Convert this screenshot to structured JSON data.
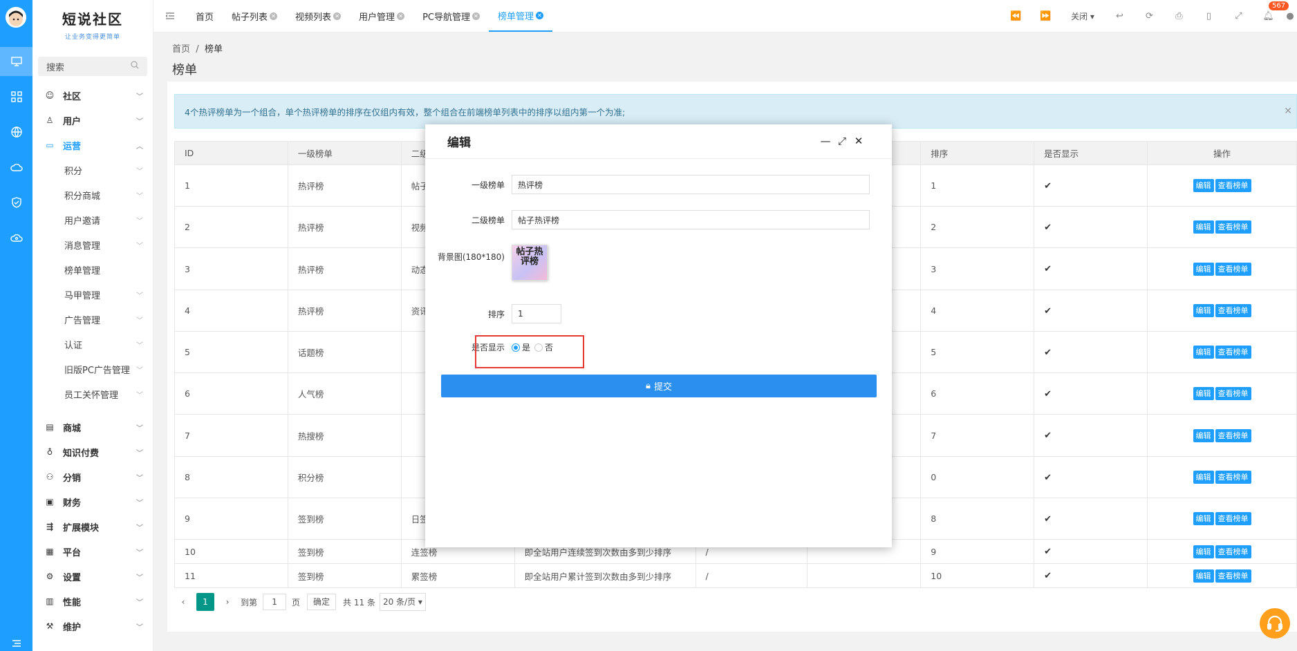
{
  "app": {
    "logo_title": "短说社区",
    "logo_slogan": "让业务变得更简单",
    "badge_count": "567"
  },
  "sidebar": {
    "search_placeholder": "搜索",
    "items": [
      {
        "label": "社区",
        "icon": "chat-icon"
      },
      {
        "label": "用户",
        "icon": "user-icon"
      },
      {
        "label": "运营",
        "icon": "monitor-icon"
      }
    ],
    "sub_items": [
      {
        "label": "积分",
        "chev": "true"
      },
      {
        "label": "积分商城",
        "chev": "true"
      },
      {
        "label": "用户邀请",
        "chev": "true"
      },
      {
        "label": "消息管理",
        "chev": "true"
      },
      {
        "label": "榜单管理",
        "chev": ""
      },
      {
        "label": "马甲管理",
        "chev": "true"
      },
      {
        "label": "广告管理",
        "chev": "true"
      },
      {
        "label": "认证",
        "chev": "true"
      },
      {
        "label": "旧版PC广告管理",
        "chev": "true"
      },
      {
        "label": "员工关怀管理",
        "chev": "true"
      }
    ],
    "items_bottom": [
      {
        "label": "商城"
      },
      {
        "label": "知识付费"
      },
      {
        "label": "分销"
      },
      {
        "label": "财务"
      },
      {
        "label": "扩展模块"
      },
      {
        "label": "平台"
      },
      {
        "label": "设置"
      },
      {
        "label": "性能"
      },
      {
        "label": "维护"
      }
    ]
  },
  "tabs": [
    {
      "label": "首页"
    },
    {
      "label": "帖子列表"
    },
    {
      "label": "视频列表"
    },
    {
      "label": "用户管理"
    },
    {
      "label": "PC导航管理"
    },
    {
      "label": "榜单管理"
    }
  ],
  "toolbar": {
    "close_label": "关闭"
  },
  "breadcrumb": {
    "home": "首页",
    "current": "榜单"
  },
  "page_title": "榜单",
  "alert_text": "4个热评榜单为一个组合，单个热评榜单的排序在仅组内有效，整个组合在前端榜单列表中的排序以组内第一个为准;",
  "table": {
    "headers": {
      "id": "ID",
      "level1": "一级榜单",
      "level2": "二级",
      "sort": "排序",
      "show": "是否显示",
      "op": "操作"
    },
    "edit_label": "编辑",
    "view_label": "查看榜单",
    "rows": [
      {
        "id": "1",
        "l1": "热评榜",
        "l2": "帖子",
        "desc": "",
        "c5": "",
        "sort": "1"
      },
      {
        "id": "2",
        "l1": "热评榜",
        "l2": "视频",
        "desc": "",
        "c5": "",
        "sort": "2"
      },
      {
        "id": "3",
        "l1": "热评榜",
        "l2": "动态",
        "desc": "",
        "c5": "",
        "sort": "3"
      },
      {
        "id": "4",
        "l1": "热评榜",
        "l2": "资讯",
        "desc": "",
        "c5": "",
        "sort": "4"
      },
      {
        "id": "5",
        "l1": "话题榜",
        "l2": "",
        "desc": "",
        "c5": "",
        "sort": "5"
      },
      {
        "id": "6",
        "l1": "人气榜",
        "l2": "",
        "desc": "",
        "c5": "",
        "sort": "6"
      },
      {
        "id": "7",
        "l1": "热搜榜",
        "l2": "",
        "desc": "",
        "c5": "",
        "sort": "7"
      },
      {
        "id": "8",
        "l1": "积分榜",
        "l2": "",
        "desc": "",
        "c5": "",
        "sort": "0"
      },
      {
        "id": "9",
        "l1": "签到榜",
        "l2": "日签",
        "desc": "",
        "c5": "",
        "sort": "8"
      },
      {
        "id": "10",
        "l1": "签到榜",
        "l2": "连签榜",
        "desc": "即全站用户连续签到次数由多到少排序",
        "c5": "/",
        "sort": "9"
      },
      {
        "id": "11",
        "l1": "签到榜",
        "l2": "累签榜",
        "desc": "即全站用户累计签到次数由多到少排序",
        "c5": "/",
        "sort": "10"
      }
    ]
  },
  "pager": {
    "current": "1",
    "goto": "到第",
    "page_input": "1",
    "page_unit": "页",
    "confirm": "确定",
    "total": "共 11 条",
    "per_page": "20 条/页"
  },
  "modal": {
    "title": "编辑",
    "level1_label": "一级榜单",
    "level1_value": "热评榜",
    "level2_label": "二级榜单",
    "level2_value": "帖子热评榜",
    "bg_label": "背景图(180*180)",
    "thumb_text": "帖子热评榜",
    "sort_label": "排序",
    "sort_value": "1",
    "show_label": "是否显示",
    "yes": "是",
    "no": "否",
    "submit": "提交"
  }
}
